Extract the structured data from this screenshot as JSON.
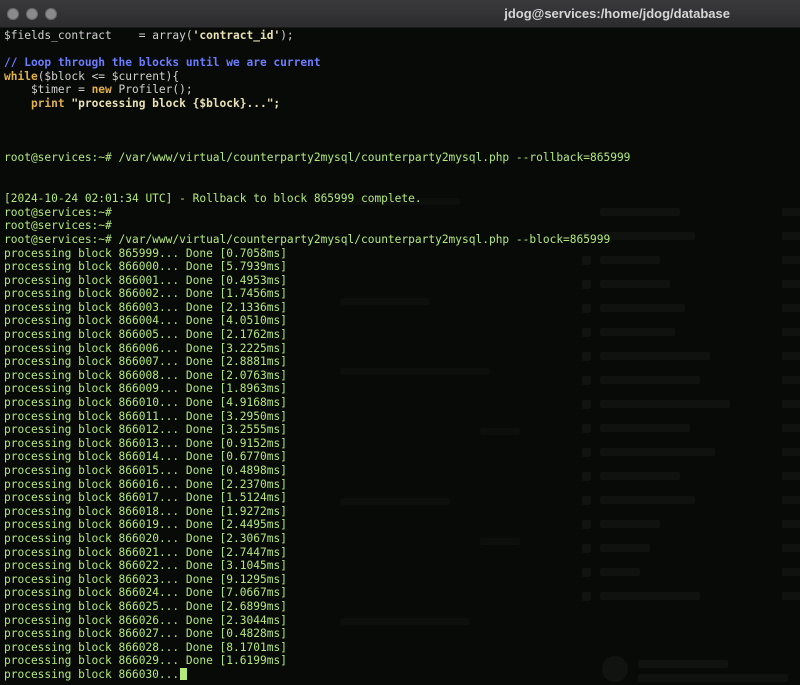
{
  "window": {
    "title": "jdog@services:/home/jdog/database"
  },
  "code": {
    "l1_var": "$fields_contract",
    "l1_eq": "    = ",
    "l1_fn": "array(",
    "l1_str": "'contract_id'",
    "l1_end": ");",
    "l3_comment": "// Loop through the blocks until we are current",
    "l4_kw": "while",
    "l4_rest": "($block <= $current){",
    "l5_var": "    $timer = ",
    "l5_kw": "new",
    "l5_rest": " Profiler();",
    "l6_kw": "    print",
    "l6_str": " \"processing block {$block}...\";"
  },
  "terminal": {
    "cmd1_prompt": "root@services:~# ",
    "cmd1": "/var/www/virtual/counterparty2mysql/counterparty2mysql.php --rollback=865999",
    "rollback_msg": "[2024-10-24 02:01:34 UTC] - Rollback to block 865999 complete.",
    "empty_prompt_1": "root@services:~#",
    "empty_prompt_2": "root@services:~#",
    "cmd2_prompt": "root@services:~# ",
    "cmd2": "/var/www/virtual/counterparty2mysql/counterparty2mysql.php --block=865999",
    "blocks": [
      {
        "block": "865999",
        "time": "0.7058ms"
      },
      {
        "block": "866000",
        "time": "5.7939ms"
      },
      {
        "block": "866001",
        "time": "0.4953ms"
      },
      {
        "block": "866002",
        "time": "1.7456ms"
      },
      {
        "block": "866003",
        "time": "2.1336ms"
      },
      {
        "block": "866004",
        "time": "4.0510ms"
      },
      {
        "block": "866005",
        "time": "2.1762ms"
      },
      {
        "block": "866006",
        "time": "3.2225ms"
      },
      {
        "block": "866007",
        "time": "2.8881ms"
      },
      {
        "block": "866008",
        "time": "2.0763ms"
      },
      {
        "block": "866009",
        "time": "1.8963ms"
      },
      {
        "block": "866010",
        "time": "4.9168ms"
      },
      {
        "block": "866011",
        "time": "3.2950ms"
      },
      {
        "block": "866012",
        "time": "3.2555ms"
      },
      {
        "block": "866013",
        "time": "0.9152ms"
      },
      {
        "block": "866014",
        "time": "0.6770ms"
      },
      {
        "block": "866015",
        "time": "0.4898ms"
      },
      {
        "block": "866016",
        "time": "2.2370ms"
      },
      {
        "block": "866017",
        "time": "1.5124ms"
      },
      {
        "block": "866018",
        "time": "1.9272ms"
      },
      {
        "block": "866019",
        "time": "2.4495ms"
      },
      {
        "block": "866020",
        "time": "2.3067ms"
      },
      {
        "block": "866021",
        "time": "2.7447ms"
      },
      {
        "block": "866022",
        "time": "3.1045ms"
      },
      {
        "block": "866023",
        "time": "9.1295ms"
      },
      {
        "block": "866024",
        "time": "7.0667ms"
      },
      {
        "block": "866025",
        "time": "2.6899ms"
      },
      {
        "block": "866026",
        "time": "2.3044ms"
      },
      {
        "block": "866027",
        "time": "0.4828ms"
      },
      {
        "block": "866028",
        "time": "8.1701ms"
      },
      {
        "block": "866029",
        "time": "1.6199ms"
      }
    ],
    "processing_prefix": "processing block ",
    "done_text": "... Done [",
    "done_close": "]",
    "last_line": "processing block 866030..."
  },
  "colors": {
    "output_green": "#b3e87a",
    "comment_blue": "#6a7cff",
    "keyword_orange": "#e0b14a"
  }
}
